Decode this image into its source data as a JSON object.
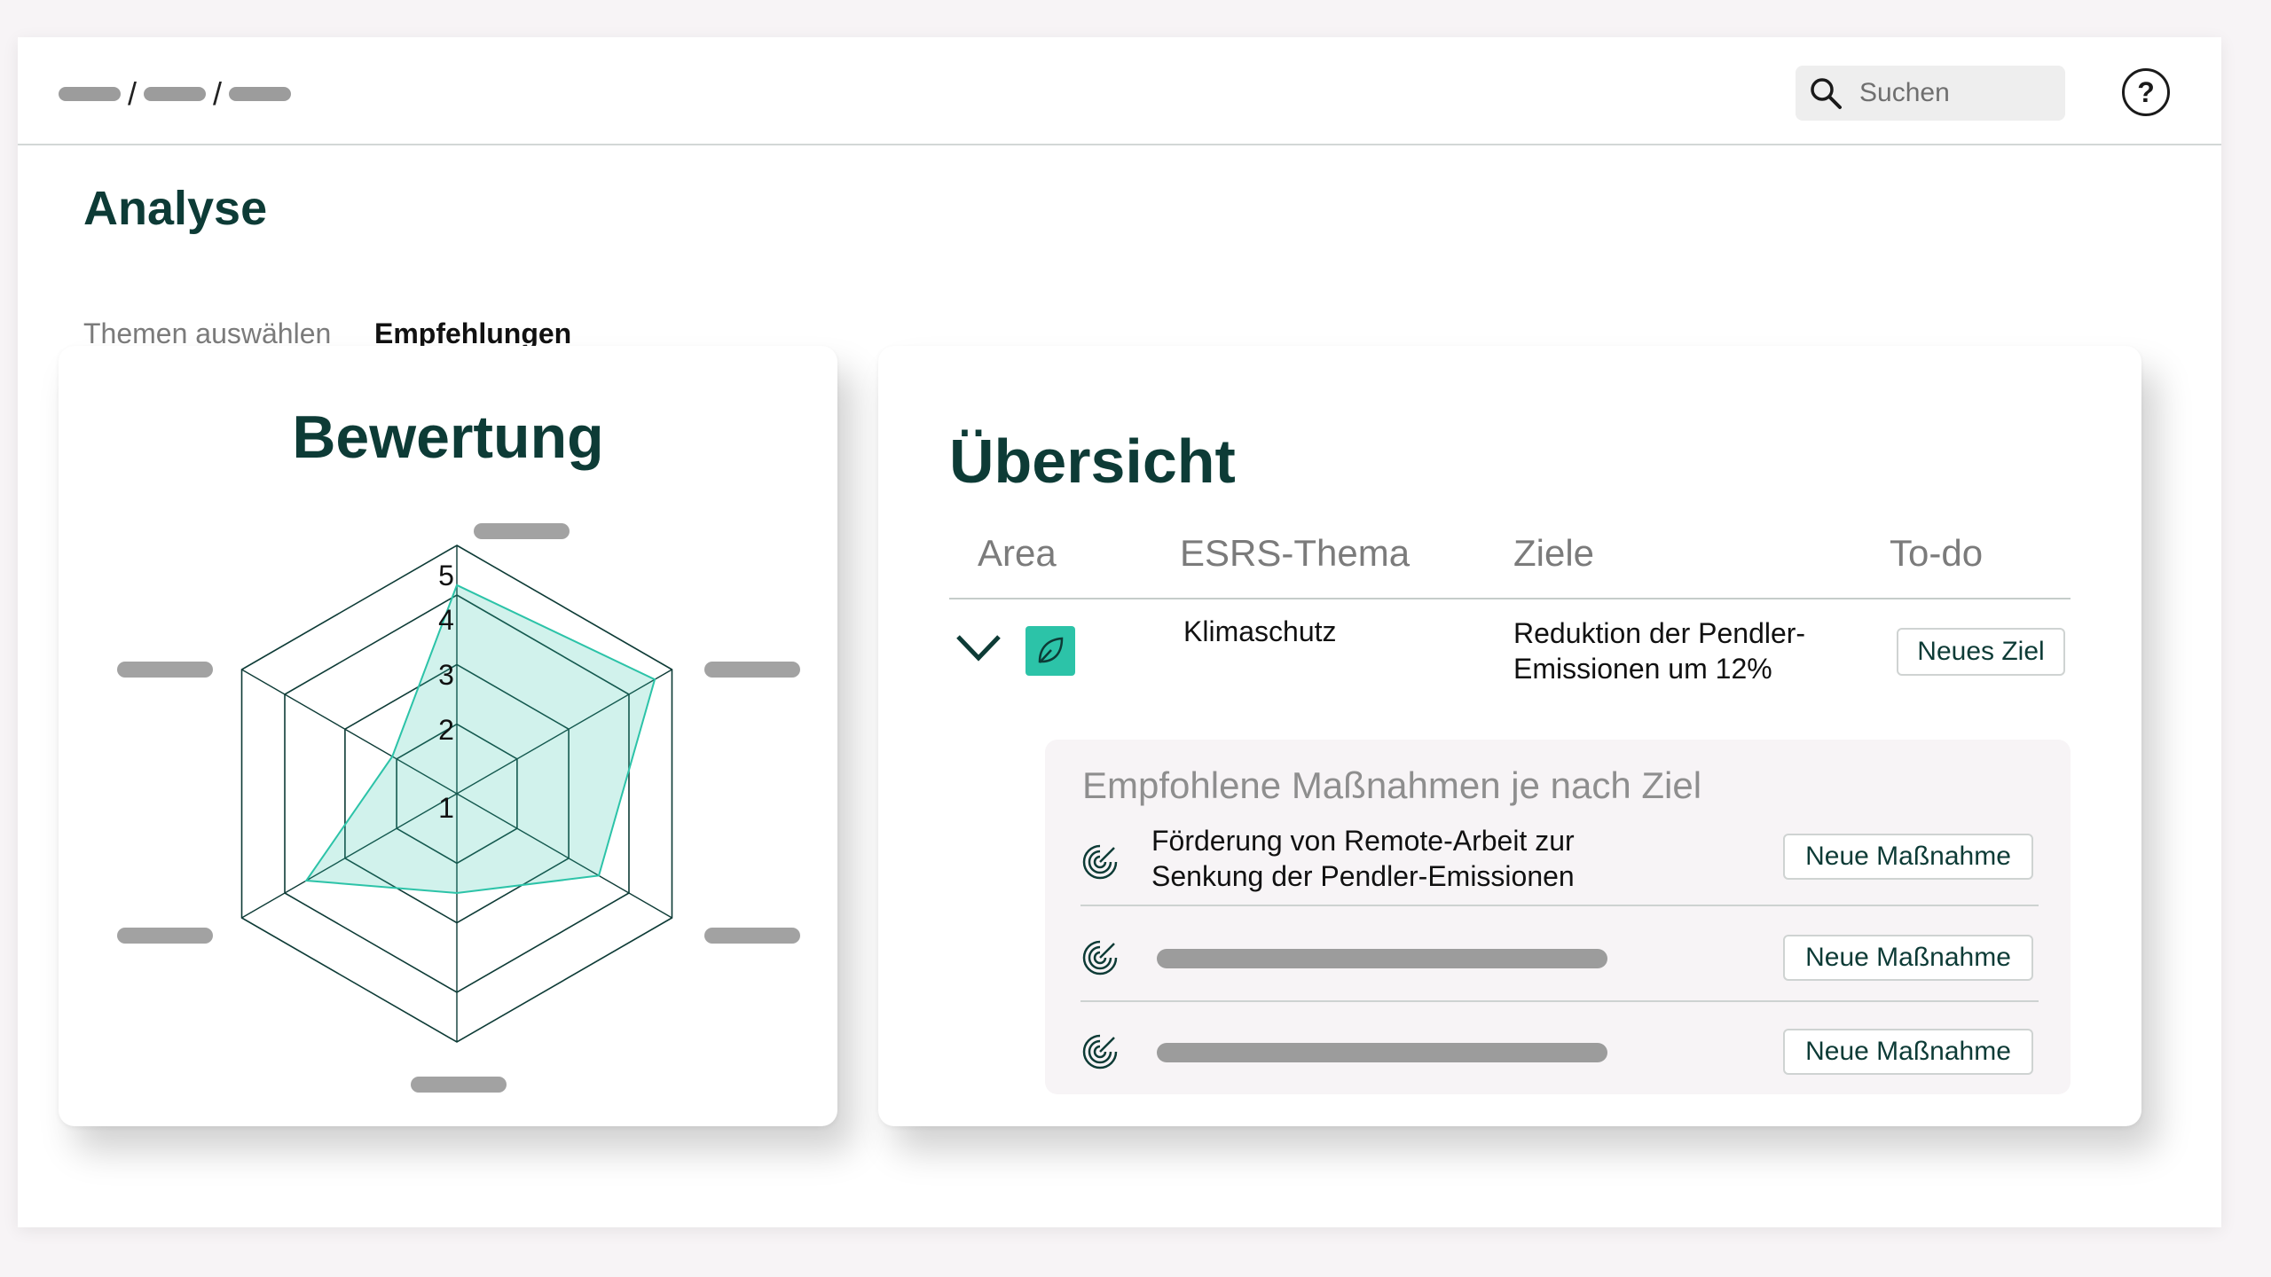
{
  "header": {
    "breadcrumb_separators": [
      "/",
      "/"
    ],
    "search": {
      "placeholder": "Suchen",
      "icon": "search-icon"
    },
    "help": {
      "label": "?",
      "icon": "help-icon"
    }
  },
  "page": {
    "title": "Analyse",
    "tabs": [
      {
        "label": "Themen auswählen",
        "active": false
      },
      {
        "label": "Empfehlungen",
        "active": true
      }
    ]
  },
  "rating": {
    "title": "Bewertung",
    "scale_labels": [
      "1",
      "2",
      "3",
      "4",
      "5"
    ],
    "chart_data": {
      "type": "radar",
      "axes": 6,
      "scale_max": 5,
      "values": [
        4.2,
        4.6,
        3.3,
        2.0,
        3.5,
        1.5
      ],
      "fill_color": "#2cc3a8"
    }
  },
  "overview": {
    "title": "Übersicht",
    "columns": [
      "Area",
      "ESRS-Thema",
      "Ziele",
      "To-do"
    ],
    "row": {
      "area_icon": "leaf-icon",
      "esrs": "Klimaschutz",
      "ziel_line1": "Reduktion der Pendler-",
      "ziel_line2": "Emissionen um 12%",
      "todo_button": "Neues Ziel"
    },
    "recommendations": {
      "title": "Empfohlene Maßnahmen je nach Ziel",
      "items": [
        {
          "line1": "Förderung von Remote-Arbeit zur",
          "line2": "Senkung der Pendler-Emissionen",
          "button": "Neue Maßnahme"
        },
        {
          "button": "Neue Maßnahme"
        },
        {
          "button": "Neue Maßnahme"
        }
      ]
    }
  },
  "colors": {
    "brand": "#0d3b36",
    "accent": "#2cc3a8"
  }
}
